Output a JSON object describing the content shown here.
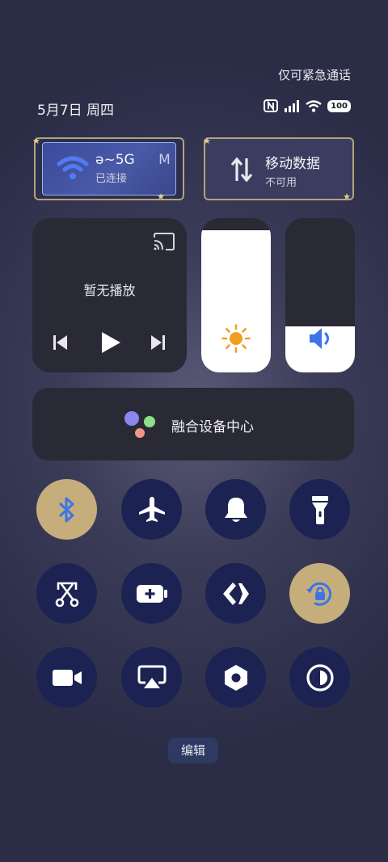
{
  "status_bar": {
    "emergency_text": "仅可紧急通话",
    "date_text": "5月7日 周四",
    "battery_level": "100",
    "icons": [
      "nfc-icon",
      "cellular-signal-icon",
      "wifi-signal-icon",
      "battery-icon"
    ]
  },
  "wifi_card": {
    "title_prefix": "ə~5G",
    "title_suffix": "M",
    "subtitle": "已连接",
    "icon": "wifi-icon",
    "accent": "#4f7cf5"
  },
  "mobile_data_card": {
    "title": "移动数据",
    "subtitle": "不可用",
    "icon": "data-transfer-icon"
  },
  "media": {
    "title": "暂无播放",
    "icons": [
      "cast-icon",
      "previous-icon",
      "play-icon",
      "next-icon"
    ]
  },
  "brightness": {
    "level": 0.92,
    "icon": "brightness-icon",
    "icon_color": "#f0a01e"
  },
  "volume": {
    "level": 0.3,
    "icon": "volume-icon",
    "icon_color": "#3f73e8"
  },
  "device_hub": {
    "label": "融合设备中心"
  },
  "toggles": [
    {
      "name": "bluetooth",
      "icon": "bluetooth-icon",
      "on": true
    },
    {
      "name": "airplane-mode",
      "icon": "airplane-icon",
      "on": false
    },
    {
      "name": "ringer",
      "icon": "bell-icon",
      "on": false
    },
    {
      "name": "flashlight",
      "icon": "flashlight-icon",
      "on": false
    },
    {
      "name": "screenshot",
      "icon": "screenshot-scissors-icon",
      "on": false
    },
    {
      "name": "battery-saver",
      "icon": "battery-plus-icon",
      "on": false
    },
    {
      "name": "nearby-share",
      "icon": "share-arrows-icon",
      "on": false
    },
    {
      "name": "rotation-lock",
      "icon": "rotation-lock-icon",
      "on": true
    },
    {
      "name": "screen-record",
      "icon": "video-camera-icon",
      "on": false
    },
    {
      "name": "screen-cast",
      "icon": "screencast-icon",
      "on": false
    },
    {
      "name": "settings",
      "icon": "hexagon-nut-icon",
      "on": false
    },
    {
      "name": "dark-mode",
      "icon": "contrast-icon",
      "on": false
    }
  ],
  "edit_button": {
    "label": "编辑"
  },
  "colors": {
    "tile_off": "#1c2352",
    "tile_on": "#c5ad7c",
    "card_gold_border": "#b5a27a"
  }
}
